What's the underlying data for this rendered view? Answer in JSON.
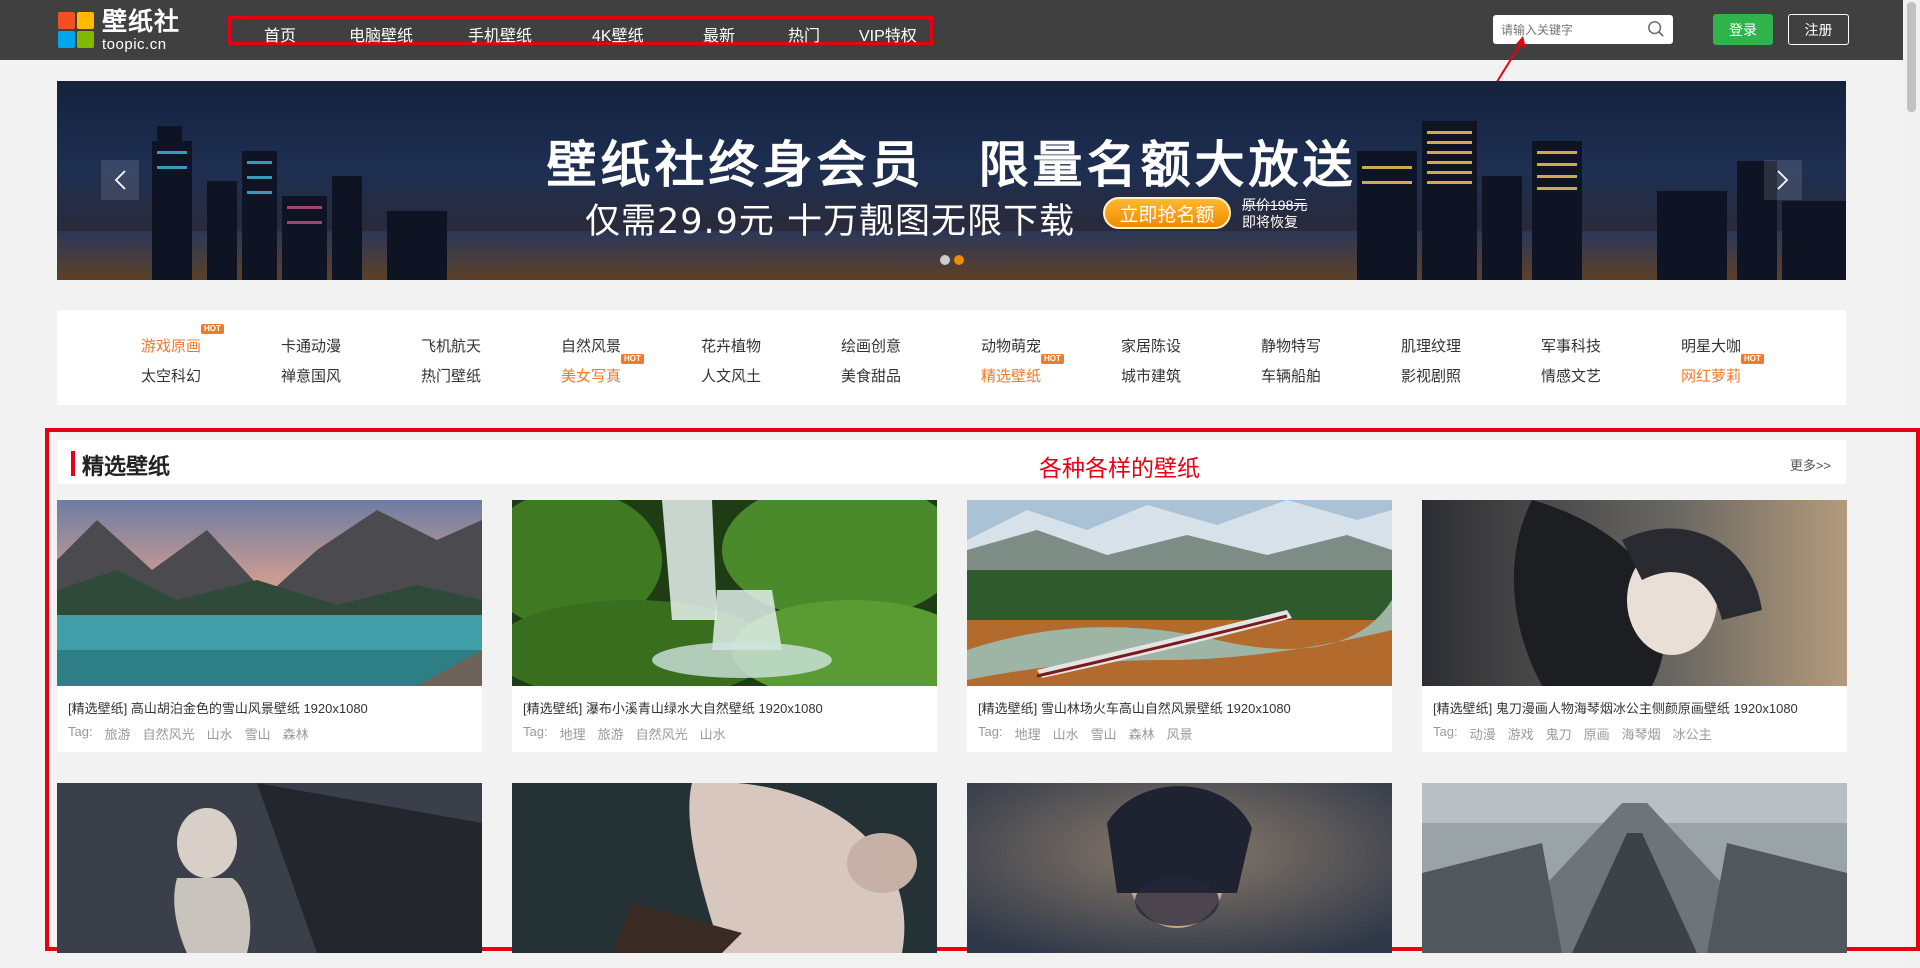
{
  "logo": {
    "cn": "壁纸社",
    "en": "toopic.cn"
  },
  "nav": [
    "首页",
    "电脑壁纸",
    "手机壁纸",
    "4K壁纸",
    "最新",
    "热门",
    "VIP特权"
  ],
  "search": {
    "placeholder": "请输入关键字"
  },
  "auth": {
    "login": "登录",
    "register": "注册"
  },
  "banner": {
    "title": "壁纸社终身会员　限量名额大放送",
    "subtitle": "仅需29.9元 十万靓图无限下载",
    "cta": "立即抢名额",
    "price_original": "原价198元",
    "price_note": "即将恢复"
  },
  "categories": {
    "row1": [
      {
        "label": "游戏原画",
        "hot": true
      },
      {
        "label": "卡通动漫",
        "hot": false
      },
      {
        "label": "飞机航天",
        "hot": false
      },
      {
        "label": "自然风景",
        "hot": false
      },
      {
        "label": "花卉植物",
        "hot": false
      },
      {
        "label": "绘画创意",
        "hot": false
      },
      {
        "label": "动物萌宠",
        "hot": false
      },
      {
        "label": "家居陈设",
        "hot": false
      },
      {
        "label": "静物特写",
        "hot": false
      },
      {
        "label": "肌理纹理",
        "hot": false
      },
      {
        "label": "军事科技",
        "hot": false
      },
      {
        "label": "明星大咖",
        "hot": false
      }
    ],
    "row2": [
      {
        "label": "太空科幻",
        "hot": false
      },
      {
        "label": "禅意国风",
        "hot": false
      },
      {
        "label": "热门壁纸",
        "hot": false
      },
      {
        "label": "美女写真",
        "hot": true
      },
      {
        "label": "人文风土",
        "hot": false
      },
      {
        "label": "美食甜品",
        "hot": false
      },
      {
        "label": "精选壁纸",
        "hot": true
      },
      {
        "label": "城市建筑",
        "hot": false
      },
      {
        "label": "车辆船舶",
        "hot": false
      },
      {
        "label": "影视剧照",
        "hot": false
      },
      {
        "label": "情感文艺",
        "hot": false
      },
      {
        "label": "网红萝莉",
        "hot": true
      }
    ],
    "hot_label": "HOT"
  },
  "featured": {
    "title": "精选壁纸",
    "annotation": "各种各样的壁纸",
    "more": "更多>>",
    "tag_prefix": "Tag:",
    "cards": [
      {
        "title": "[精选壁纸] 高山胡泊金色的雪山风景壁纸  1920x1080",
        "tags": [
          "旅游",
          "自然风光",
          "山水",
          "雪山",
          "森林"
        ]
      },
      {
        "title": "[精选壁纸] 瀑布小溪青山绿水大自然壁纸  1920x1080",
        "tags": [
          "地理",
          "旅游",
          "自然风光",
          "山水"
        ]
      },
      {
        "title": "[精选壁纸] 雪山林场火车高山自然风景壁纸  1920x1080",
        "tags": [
          "地理",
          "山水",
          "雪山",
          "森林",
          "风景"
        ]
      },
      {
        "title": "[精选壁纸] 鬼刀漫画人物海琴烟冰公主侧颜原画壁纸  1920x1080",
        "tags": [
          "动漫",
          "游戏",
          "鬼刀",
          "原画",
          "海琴烟",
          "冰公主"
        ]
      }
    ]
  },
  "colors": {
    "header": "#404040",
    "accent_red": "#e60012",
    "hot_orange": "#f0792a",
    "login_green": "#2fb34a"
  }
}
